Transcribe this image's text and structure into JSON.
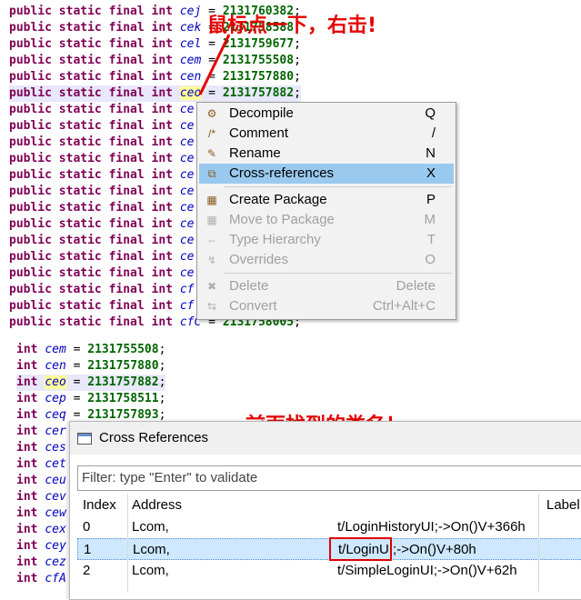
{
  "code_top": {
    "lines": [
      {
        "kw": "public static final int",
        "name": "cej",
        "value": "2131760382",
        "highlight": false
      },
      {
        "kw": "public static final int",
        "name": "cek",
        "value": "2131758588",
        "highlight": false
      },
      {
        "kw": "public static final int",
        "name": "cel",
        "value": "2131759677",
        "highlight": false
      },
      {
        "kw": "public static final int",
        "name": "cem",
        "value": "2131755508",
        "highlight": false
      },
      {
        "kw": "public static final int",
        "name": "cen",
        "value": "2131757880",
        "highlight": false
      },
      {
        "kw": "public static final int",
        "name": "ceo",
        "value": "2131757882",
        "highlight": true
      },
      {
        "kw": "public static final int",
        "name": "ce",
        "value": "",
        "highlight": false
      },
      {
        "kw": "public static final int",
        "name": "ce",
        "value": "",
        "highlight": false
      },
      {
        "kw": "public static final int",
        "name": "ce",
        "value": "",
        "highlight": false
      },
      {
        "kw": "public static final int",
        "name": "ce",
        "value": "",
        "highlight": false
      },
      {
        "kw": "public static final int",
        "name": "ce",
        "value": "",
        "highlight": false
      },
      {
        "kw": "public static final int",
        "name": "ce",
        "value": "",
        "highlight": false
      },
      {
        "kw": "public static final int",
        "name": "ce",
        "value": "",
        "highlight": false
      },
      {
        "kw": "public static final int",
        "name": "ce",
        "value": "",
        "highlight": false
      },
      {
        "kw": "public static final int",
        "name": "ce",
        "value": "",
        "highlight": false
      },
      {
        "kw": "public static final int",
        "name": "ce",
        "value": "",
        "highlight": false
      },
      {
        "kw": "public static final int",
        "name": "ce",
        "value": "",
        "highlight": false
      },
      {
        "kw": "public static final int",
        "name": "cf",
        "value": "",
        "highlight": false
      },
      {
        "kw": "public static final int",
        "name": "cf",
        "value": "",
        "highlight": false
      },
      {
        "kw": "public static final int",
        "name": "cfC",
        "value": "2131758005",
        "highlight": false
      }
    ]
  },
  "code_bottom": {
    "lines": [
      {
        "kw": "int",
        "name": "cem",
        "value": "2131755508",
        "highlight": false
      },
      {
        "kw": "int",
        "name": "cen",
        "value": "2131757880",
        "highlight": false
      },
      {
        "kw": "int",
        "name": "ceo",
        "value": "2131757882",
        "highlight": true
      },
      {
        "kw": "int",
        "name": "cep",
        "value": "2131758511",
        "highlight": false
      },
      {
        "kw": "int",
        "name": "ceq",
        "value": "2131757893",
        "highlight": false
      },
      {
        "kw": "int",
        "name": "cer",
        "value": "",
        "highlight": false
      },
      {
        "kw": "int",
        "name": "ces",
        "value": "",
        "highlight": false
      },
      {
        "kw": "int",
        "name": "cet",
        "value": "",
        "highlight": false
      },
      {
        "kw": "int",
        "name": "ceu",
        "value": "",
        "highlight": false
      },
      {
        "kw": "int",
        "name": "cev",
        "value": "",
        "highlight": false
      },
      {
        "kw": "int",
        "name": "cew",
        "value": "",
        "highlight": false
      },
      {
        "kw": "int",
        "name": "cex",
        "value": "",
        "highlight": false
      },
      {
        "kw": "int",
        "name": "cey",
        "value": "",
        "highlight": false
      },
      {
        "kw": "int",
        "name": "cez",
        "value": "",
        "highlight": false
      },
      {
        "kw": "int",
        "name": "cfA",
        "value": "",
        "highlight": false
      }
    ]
  },
  "context_menu": {
    "items": [
      {
        "label": "Decompile",
        "shortcut": "Q",
        "icon": "decompile-icon",
        "glyph": "⚙",
        "disabled": false,
        "selected": false
      },
      {
        "label": "Comment",
        "shortcut": "/",
        "icon": "comment-icon",
        "glyph": "/*",
        "disabled": false,
        "selected": false
      },
      {
        "label": "Rename",
        "shortcut": "N",
        "icon": "rename-pencil-icon",
        "glyph": "✎",
        "disabled": false,
        "selected": false
      },
      {
        "label": "Cross-references",
        "shortcut": "X",
        "icon": "cross-references-icon",
        "glyph": "⧉",
        "disabled": false,
        "selected": true
      },
      {
        "label": "Create Package",
        "shortcut": "P",
        "icon": "package-icon",
        "glyph": "▦",
        "disabled": false,
        "selected": false
      },
      {
        "label": "Move to Package",
        "shortcut": "M",
        "icon": "move-package-icon",
        "glyph": "▦",
        "disabled": true,
        "selected": false
      },
      {
        "label": "Type Hierarchy",
        "shortcut": "T",
        "icon": "type-hierarchy-icon",
        "glyph": "⇔",
        "disabled": true,
        "selected": false
      },
      {
        "label": "Overrides",
        "shortcut": "O",
        "icon": "overrides-icon",
        "glyph": "↯",
        "disabled": true,
        "selected": false
      },
      {
        "label": "Delete",
        "shortcut": "Delete",
        "icon": "delete-icon",
        "glyph": "✖",
        "disabled": true,
        "selected": false
      },
      {
        "label": "Convert",
        "shortcut": "Ctrl+Alt+C",
        "icon": "convert-icon",
        "glyph": "⇆",
        "disabled": true,
        "selected": false
      }
    ]
  },
  "annotations": {
    "right_click": "鼠标点一下，右击!",
    "class_found": "前面找到的类名！"
  },
  "xref_dialog": {
    "title": "Cross References",
    "filter_placeholder": "Filter: type \"Enter\" to validate",
    "columns": {
      "index": "Index",
      "address": "Address",
      "label": "Label"
    },
    "rows": [
      {
        "index": "0",
        "cls": "Lcom,",
        "address": "t/LoginHistoryUI;->On()V+366h",
        "selected": false
      },
      {
        "index": "1",
        "cls": "Lcom,",
        "address": "t/LoginUI;->On()V+80h",
        "selected": true
      },
      {
        "index": "2",
        "cls": "Lcom,",
        "address": "t/SimpleLoginUI;->On()V+62h",
        "selected": false
      }
    ]
  },
  "colors": {
    "accent_red": "#e60000",
    "menu_selected": "#99c9ef"
  }
}
